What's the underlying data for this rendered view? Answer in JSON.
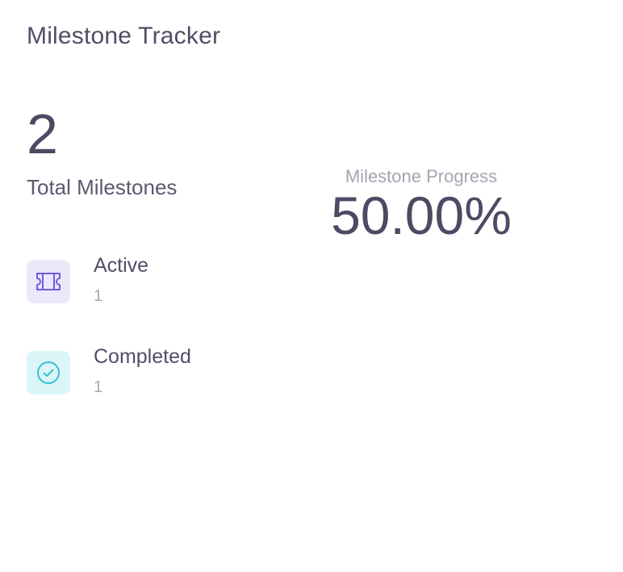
{
  "card": {
    "title": "Milestone Tracker"
  },
  "summary": {
    "total_value": "2",
    "total_label": "Total Milestones"
  },
  "progress": {
    "label": "Milestone Progress",
    "value_text": "50.00%",
    "value": 50.0
  },
  "stats": [
    {
      "label": "Active",
      "count": "1",
      "icon": "ticket-icon",
      "icon_color": "#6c5ee0",
      "icon_bg": "#ebe8fb"
    },
    {
      "label": "Completed",
      "count": "1",
      "icon": "check-circle-icon",
      "icon_color": "#36c2d6",
      "icon_bg": "#dcf5f8"
    }
  ]
}
